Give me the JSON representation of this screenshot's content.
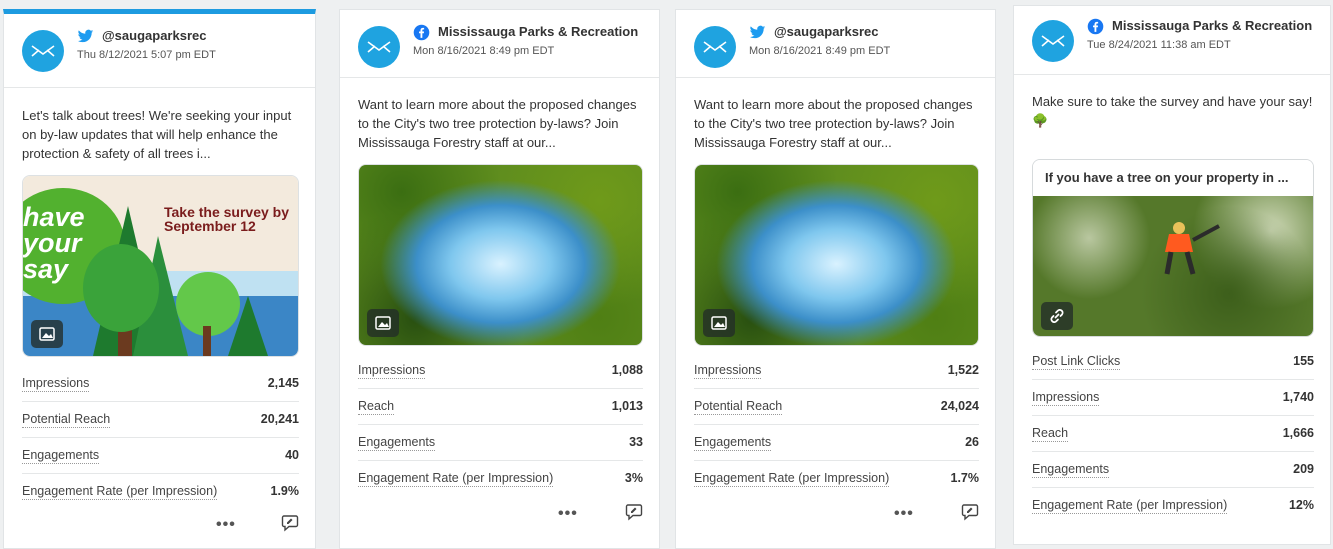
{
  "posts": [
    {
      "network": "twitter",
      "account": "@saugaparksrec",
      "date": "Thu 8/12/2021 5:07 pm EDT",
      "text": "Let's talk about trees! We're seeking your input on by-law updates that will help enhance the protection & safety of all trees i...",
      "image": {
        "kind": "survey-graphic",
        "headline": "have your say",
        "cta_line1": "Take the survey by",
        "cta_line2": "September 12"
      },
      "stats": [
        {
          "label": "Impressions",
          "value": "2,145"
        },
        {
          "label": "Potential Reach",
          "value": "20,241"
        },
        {
          "label": "Engagements",
          "value": "40"
        },
        {
          "label": "Engagement Rate (per Impression)",
          "value": "1.9%"
        }
      ]
    },
    {
      "network": "facebook",
      "account": "Mississauga Parks & Recreation",
      "date": "Mon 8/16/2021 8:49 pm EDT",
      "text": "Want to learn more about the proposed changes to the City's two tree protection by-laws? Join Mississauga Forestry staff at our...",
      "image": {
        "kind": "forest-canopy"
      },
      "stats": [
        {
          "label": "Impressions",
          "value": "1,088"
        },
        {
          "label": "Reach",
          "value": "1,013"
        },
        {
          "label": "Engagements",
          "value": "33"
        },
        {
          "label": "Engagement Rate (per Impression)",
          "value": "3%"
        }
      ]
    },
    {
      "network": "twitter",
      "account": "@saugaparksrec",
      "date": "Mon 8/16/2021 8:49 pm EDT",
      "text": "Want to learn more about the proposed changes to the City's two tree protection by-laws? Join Mississauga Forestry staff at our...",
      "image": {
        "kind": "forest-canopy"
      },
      "stats": [
        {
          "label": "Impressions",
          "value": "1,522"
        },
        {
          "label": "Potential Reach",
          "value": "24,024"
        },
        {
          "label": "Engagements",
          "value": "26"
        },
        {
          "label": "Engagement Rate (per Impression)",
          "value": "1.7%"
        }
      ]
    },
    {
      "network": "facebook",
      "account": "Mississauga Parks & Recreation",
      "date": "Tue 8/24/2021 11:38 am EDT",
      "text": "Make sure to take the survey and have your say! 🌳",
      "link_title": "If you have a tree on your property in ...",
      "image": {
        "kind": "arborist-photo"
      },
      "stats": [
        {
          "label": "Post Link Clicks",
          "value": "155"
        },
        {
          "label": "Impressions",
          "value": "1,740"
        },
        {
          "label": "Reach",
          "value": "1,666"
        },
        {
          "label": "Engagements",
          "value": "209"
        },
        {
          "label": "Engagement Rate (per Impression)",
          "value": "12%"
        }
      ]
    }
  ],
  "more_label": "•••",
  "colors": {
    "twitter": "#1d9bf0",
    "facebook": "#1877f2",
    "avatar": "#1fa3e0",
    "active_bar": "#1d9be0"
  },
  "icons": [
    "twitter-icon",
    "facebook-icon",
    "image-icon",
    "link-icon",
    "comment-icon",
    "more-icon"
  ]
}
